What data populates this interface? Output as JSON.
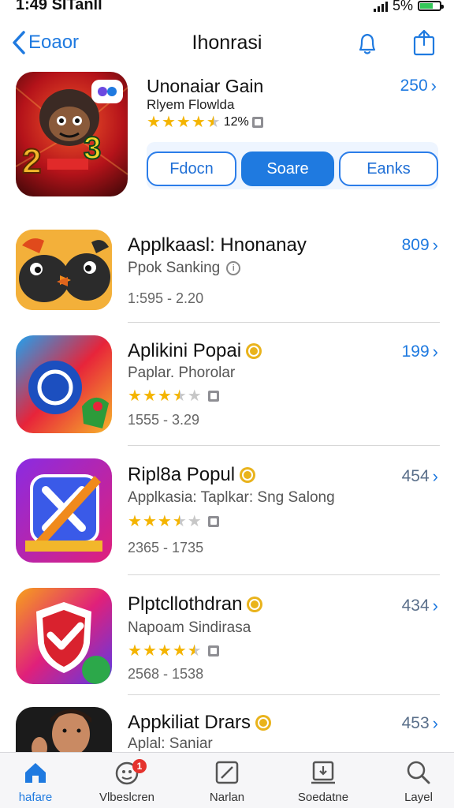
{
  "status_bar": {
    "time": "1:49 SITanll",
    "battery": "5%"
  },
  "nav": {
    "back_label": "Eoaor",
    "title": "Ihonrasi"
  },
  "featured": {
    "title": "Unonaiar Gain",
    "subtitle": "Rlyem Flowlda",
    "rating_text": "12%",
    "price": "250",
    "rating": 4.5,
    "buttons": [
      "Fdocn",
      "Soare",
      "Eanks"
    ],
    "active_button": 1
  },
  "apps": [
    {
      "title": "Applkaasl: Hnonanay",
      "subtitle": "Ppok Sanking",
      "meta": "1:595 - 2.20",
      "price": "809"
    },
    {
      "title": "Aplikini Popai",
      "subtitle": "Paplar. Phorolar",
      "meta": "1555 - 3.29",
      "price": "199",
      "rating": 3.5
    },
    {
      "title": "Ripl8a Popul",
      "subtitle": "Applkasia: Taplkar: Sng Salong",
      "meta": "2365 - 1735",
      "price": "454",
      "rating": 3.5
    },
    {
      "title": "Plptcllothdran",
      "subtitle": "Napoam Sindirasa",
      "meta": "2568 - 1538",
      "price": "434",
      "rating": 4.5
    },
    {
      "title": "Appkiliat Drars",
      "subtitle": "Aplal: Saniar",
      "price": "453"
    }
  ],
  "tabs": [
    {
      "label": "hafare",
      "icon": "home-icon"
    },
    {
      "label": "Vlbeslcren",
      "icon": "games-icon",
      "badge": "1"
    },
    {
      "label": "Narlan",
      "icon": "apps-icon"
    },
    {
      "label": "Soedatne",
      "icon": "updates-icon"
    },
    {
      "label": "Layel",
      "icon": "search-icon"
    }
  ],
  "colors": {
    "accent": "#1f7ae0",
    "star": "#f4b400",
    "badge": "#e5322d"
  }
}
